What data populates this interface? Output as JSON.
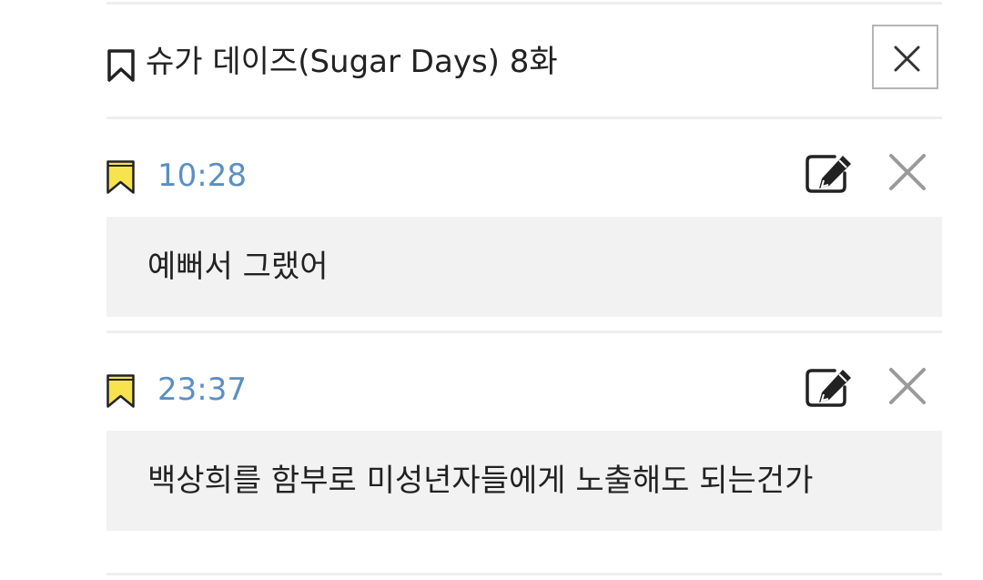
{
  "header": {
    "title": "슈가 데이즈(Sugar Days) 8화",
    "bookmark_icon": "bookmark-outline-icon",
    "close_icon": "close-icon"
  },
  "bookmarks": [
    {
      "time": "10:28",
      "note": "예뻐서 그랬어",
      "icon": "bookmark-yellow-icon",
      "edit_icon": "edit-icon",
      "delete_icon": "delete-icon"
    },
    {
      "time": "23:37",
      "note": "백상희를 함부로 미성년자들에게 노출해도 되는건가",
      "icon": "bookmark-yellow-icon",
      "edit_icon": "edit-icon",
      "delete_icon": "delete-icon"
    }
  ],
  "colors": {
    "time_text": "#5b8fc2",
    "bookmark_fill": "#f7e34d",
    "note_background": "#f2f2f2",
    "divider": "#eeeeee",
    "icon_gray": "#9a9a9a",
    "text": "#222222"
  }
}
